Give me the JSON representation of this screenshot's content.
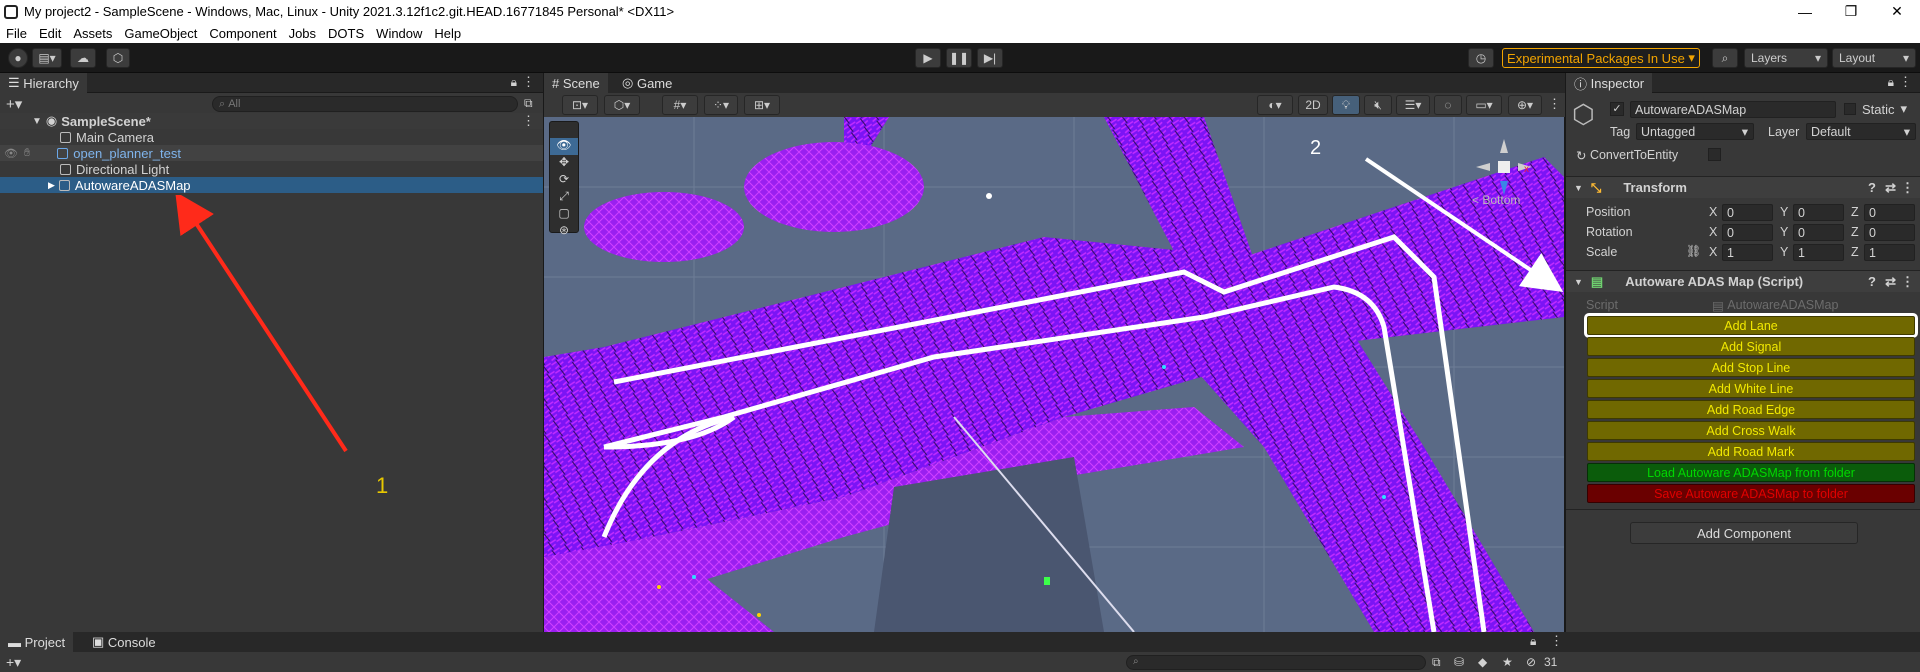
{
  "window": {
    "title": "My project2 - SampleScene - Windows, Mac, Linux - Unity 2021.3.12f1c2.git.HEAD.16771845 Personal* <DX11>",
    "min": "—",
    "max": "❐",
    "close": "✕"
  },
  "menu": [
    "File",
    "Edit",
    "Assets",
    "GameObject",
    "Component",
    "Jobs",
    "DOTS",
    "Window",
    "Help"
  ],
  "toolbar": {
    "experimental": "Experimental Packages In Use",
    "layers": "Layers",
    "layout": "Layout"
  },
  "hierarchy": {
    "tab": "Hierarchy",
    "search_placeholder": "All",
    "scene": "SampleScene*",
    "items": [
      "Main Camera",
      "open_planner_test",
      "Directional Light",
      "AutowareADASMap"
    ]
  },
  "scene": {
    "tab_scene": "Scene",
    "tab_game": "Game",
    "mode_2d": "2D",
    "gizmo_label": "< Bottom"
  },
  "annotations": {
    "one": "1",
    "two": "2"
  },
  "inspector": {
    "tab": "Inspector",
    "object_name": "AutowareADASMap",
    "static_label": "Static",
    "tag_label": "Tag",
    "tag_value": "Untagged",
    "layer_label": "Layer",
    "layer_value": "Default",
    "convert_label": "ConvertToEntity",
    "transform": {
      "title": "Transform",
      "position_label": "Position",
      "rotation_label": "Rotation",
      "scale_label": "Scale",
      "position": [
        "0",
        "0",
        "0"
      ],
      "rotation": [
        "0",
        "0",
        "0"
      ],
      "scale": [
        "1",
        "1",
        "1"
      ]
    },
    "script_component": {
      "title": "Autoware ADAS Map (Script)",
      "script_label": "Script",
      "script_value": "AutowareADASMap",
      "buttons": [
        "Add Lane",
        "Add Signal",
        "Add Stop Line",
        "Add White Line",
        "Add Road Edge",
        "Add Cross Walk",
        "Add Road Mark"
      ],
      "load_button": "Load Autoware ADASMap from folder",
      "save_button": "Save Autoware ADASMap to folder"
    },
    "add_component": "Add Component"
  },
  "bottom": {
    "project_tab": "Project",
    "console_tab": "Console",
    "count": "31"
  },
  "colors": {
    "accent_yellow": "#f2e900",
    "button_olive": "#706800",
    "load_green": "#00c800",
    "save_red": "#d00000",
    "selection": "#2c5d87",
    "point_purple": "#8a1cff"
  }
}
